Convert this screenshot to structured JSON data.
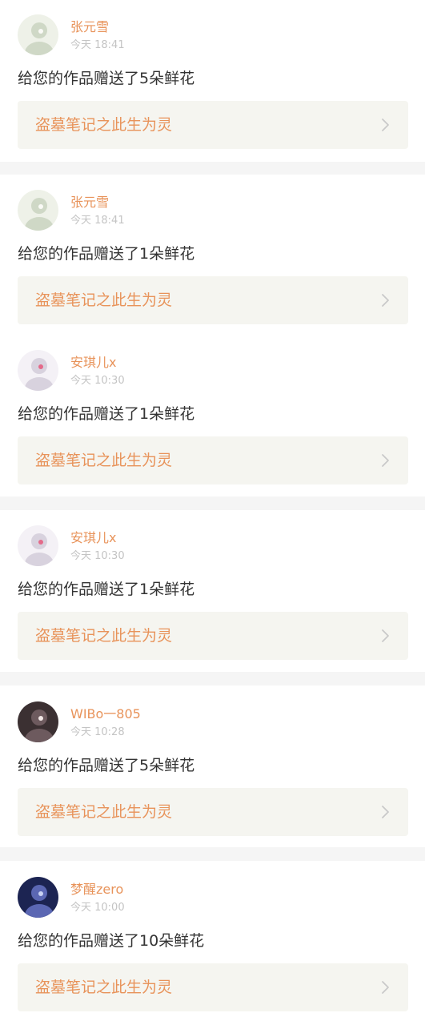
{
  "notifications": [
    {
      "username": "张元雪",
      "time": "今天 18:41",
      "message": "给您的作品赠送了5朵鲜花",
      "work_title": "盗墓笔记之此生为灵",
      "avatar_colors": [
        "#eef1e8",
        "#cfd8c6",
        "#fafaf6"
      ]
    },
    {
      "username": "张元雪",
      "time": "今天 18:41",
      "message": "给您的作品赠送了1朵鲜花",
      "work_title": "盗墓笔记之此生为灵",
      "avatar_colors": [
        "#eef1e8",
        "#cfd8c6",
        "#fafaf6"
      ]
    },
    {
      "username": "安琪儿x",
      "time": "今天 10:30",
      "message": "给您的作品赠送了1朵鲜花",
      "work_title": "盗墓笔记之此生为灵",
      "avatar_colors": [
        "#f4f1f6",
        "#d8d2de",
        "#e46a8a"
      ]
    },
    {
      "username": "安琪儿x",
      "time": "今天 10:30",
      "message": "给您的作品赠送了1朵鲜花",
      "work_title": "盗墓笔记之此生为灵",
      "avatar_colors": [
        "#f4f1f6",
        "#d8d2de",
        "#e46a8a"
      ]
    },
    {
      "username": "WIBo一805",
      "time": "今天 10:28",
      "message": "给您的作品赠送了5朵鲜花",
      "work_title": "盗墓笔记之此生为灵",
      "avatar_colors": [
        "#3b3032",
        "#6d5a5e",
        "#f1e7e6"
      ]
    },
    {
      "username": "梦醒zero",
      "time": "今天 10:00",
      "message": "给您的作品赠送了10朵鲜花",
      "work_title": "盗墓笔记之此生为灵",
      "avatar_colors": [
        "#1c2452",
        "#5b67b3",
        "#c9d2f2"
      ]
    }
  ],
  "colors": {
    "accent": "#e8935a",
    "time": "#c4c4c4",
    "message": "#333333",
    "work_bg": "#f5f5f0",
    "separator": "#f5f5f5"
  },
  "icons": {
    "chevron": "chevron-right-icon",
    "avatar": "avatar"
  }
}
